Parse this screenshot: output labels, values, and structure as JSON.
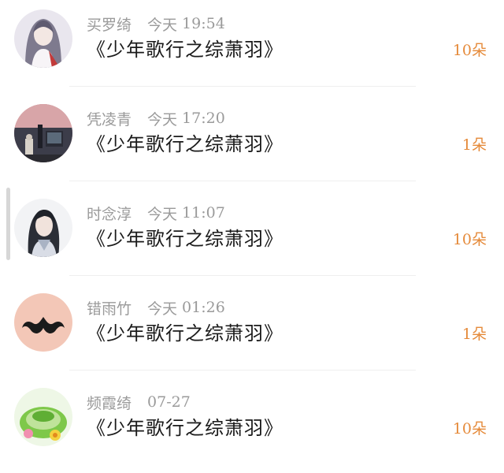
{
  "rows": [
    {
      "name": "买罗绮",
      "date": "今天",
      "time": "19:54",
      "title": "《少年歌行之综萧羽》",
      "gift": "10朵",
      "avatar_icon": "anime-girl-avatar-icon"
    },
    {
      "name": "凭凌青",
      "date": "今天",
      "time": "17:20",
      "title": "《少年歌行之综萧羽》",
      "gift": "1朵",
      "avatar_icon": "city-scene-avatar-icon"
    },
    {
      "name": "时念淳",
      "date": "今天",
      "time": "11:07",
      "title": "《少年歌行之综萧羽》",
      "gift": "10朵",
      "avatar_icon": "anime-man-avatar-icon"
    },
    {
      "name": "错雨竹",
      "date": "今天",
      "time": "01:26",
      "title": "《少年歌行之综萧羽》",
      "gift": "1朵",
      "avatar_icon": "mustache-avatar-icon"
    },
    {
      "name": "频霞绮",
      "date": "",
      "time": "07-27",
      "title": "《少年歌行之综萧羽》",
      "gift": "10朵",
      "avatar_icon": "green-craft-avatar-icon"
    }
  ],
  "colors": {
    "gift": "#e58a3a",
    "meta": "#9a9a9a",
    "title": "#1a1a1a"
  }
}
